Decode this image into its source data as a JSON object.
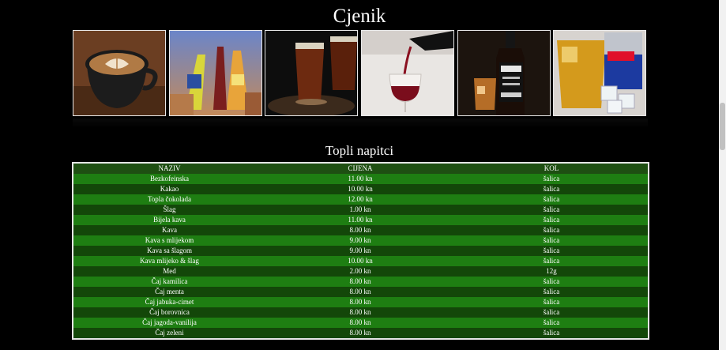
{
  "page": {
    "title": "Cjenik"
  },
  "gallery": [
    {
      "name": "coffee-photo"
    },
    {
      "name": "fanta-bottles-photo"
    },
    {
      "name": "beer-glasses-photo"
    },
    {
      "name": "wine-pour-photo"
    },
    {
      "name": "whiskey-bottle-photo"
    },
    {
      "name": "red-bull-photo"
    }
  ],
  "section": {
    "title": "Topli napitci"
  },
  "table": {
    "headers": {
      "name": "NAZIV",
      "price": "CIJENA",
      "qty": "KOL"
    },
    "rows": [
      {
        "name": "Bezkofeinska",
        "price": "11.00 kn",
        "qty": "šalica"
      },
      {
        "name": "Kakao",
        "price": "10.00 kn",
        "qty": "šalica"
      },
      {
        "name": "Topla čokolada",
        "price": "12.00 kn",
        "qty": "šalica"
      },
      {
        "name": "Šlag",
        "price": "1.00 kn",
        "qty": "šalica"
      },
      {
        "name": "Bijela kava",
        "price": "11.00 kn",
        "qty": "šalica"
      },
      {
        "name": "Kava",
        "price": "8.00 kn",
        "qty": "šalica"
      },
      {
        "name": "Kava s mlijekom",
        "price": "9.00 kn",
        "qty": "šalica"
      },
      {
        "name": "Kava sa šlagom",
        "price": "9.00 kn",
        "qty": "šalica"
      },
      {
        "name": "Kava mlijeko & šlag",
        "price": "10.00 kn",
        "qty": "šalica"
      },
      {
        "name": "Med",
        "price": "2.00 kn",
        "qty": "12g"
      },
      {
        "name": "Čaj kamilica",
        "price": "8.00 kn",
        "qty": "šalica"
      },
      {
        "name": "Čaj menta",
        "price": "8.00 kn",
        "qty": "šalica"
      },
      {
        "name": "Čaj jabuka-cimet",
        "price": "8.00 kn",
        "qty": "šalica"
      },
      {
        "name": "Čaj borovnica",
        "price": "8.00 kn",
        "qty": "šalica"
      },
      {
        "name": "Čaj jagoda-vanilija",
        "price": "8.00 kn",
        "qty": "šalica"
      },
      {
        "name": "Čaj zeleni",
        "price": "8.00 kn",
        "qty": "šalica"
      }
    ]
  }
}
